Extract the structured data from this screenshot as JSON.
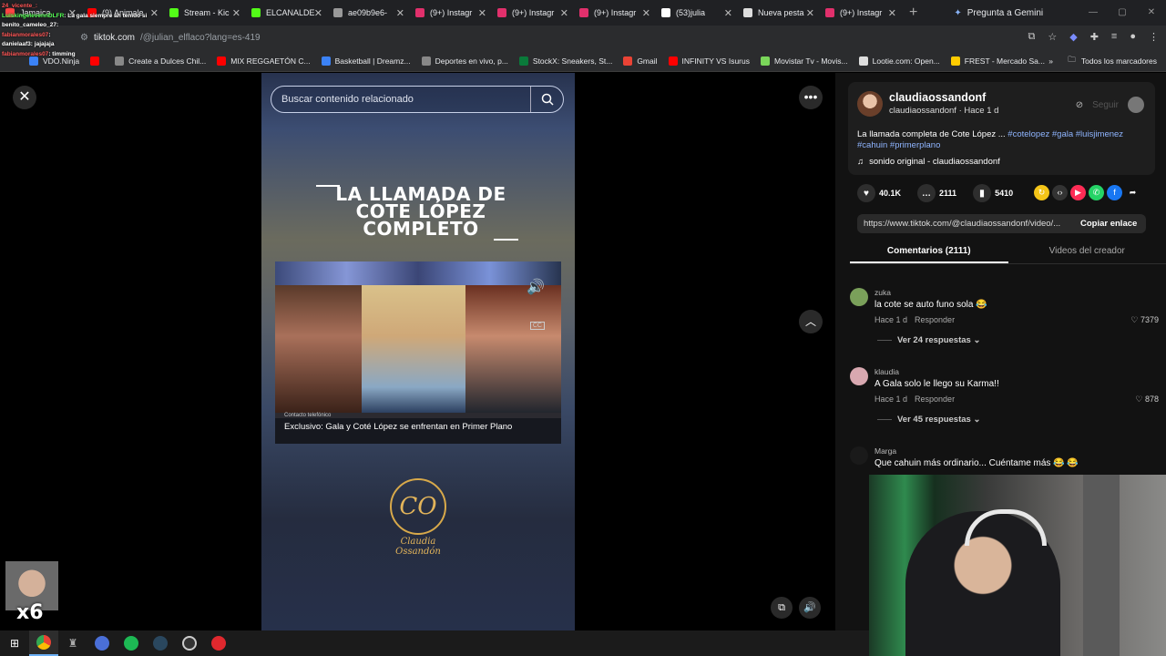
{
  "browser": {
    "tabs": [
      {
        "label": "Jamaica",
        "icon_color": "#ff4444"
      },
      {
        "label": "(9) Animale",
        "icon_color": "#ff0000"
      },
      {
        "label": "Stream - Kic",
        "icon_color": "#53fc18"
      },
      {
        "label": "ELCANALDE",
        "icon_color": "#53fc18"
      },
      {
        "label": "ae09b9e6-",
        "icon_color": "#999999"
      },
      {
        "label": "(9+) Instagr",
        "icon_color": "#e1306c"
      },
      {
        "label": "(9+) Instagr",
        "icon_color": "#e1306c"
      },
      {
        "label": "(9+) Instagr",
        "icon_color": "#e1306c"
      },
      {
        "label": "(53)julia",
        "icon_color": "#ffffff"
      },
      {
        "label": "Nueva pesta",
        "icon_color": "#dddddd"
      },
      {
        "label": "(9+) Instagr",
        "icon_color": "#e1306c"
      }
    ],
    "gemini_label": "Pregunta a Gemini",
    "address": {
      "domain": "tiktok.com",
      "path": "/@julian_elflaco?lang=es-419"
    },
    "bookmarks": [
      {
        "label": "VDO.Ninja",
        "color": "#3b82f6"
      },
      {
        "label": "",
        "color": "#ff0000"
      },
      {
        "label": "Create a Dulces Chil...",
        "color": "#888888"
      },
      {
        "label": "MIX REGGAETÓN C...",
        "color": "#ff0000"
      },
      {
        "label": "Basketball | Dreamz...",
        "color": "#3b82f6"
      },
      {
        "label": "Deportes en vivo, p...",
        "color": "#888888"
      },
      {
        "label": "StockX: Sneakers, St...",
        "color": "#0a7a3a"
      },
      {
        "label": "Gmail",
        "color": "#ea4335"
      },
      {
        "label": "INFINITY VS Isurus",
        "color": "#ff0000"
      },
      {
        "label": "Movistar Tv - Movis...",
        "color": "#7ad65a"
      },
      {
        "label": "Lootie.com: Open...",
        "color": "#dddddd"
      },
      {
        "label": "FREST - Mercado Sa...",
        "color": "#ffcc00"
      }
    ],
    "all_bookmarks": "Todos los marcadores"
  },
  "chat": [
    {
      "user": "24_vicente_:",
      "text": "",
      "color": "#ff5555"
    },
    {
      "user": "LuiskingelevennDLFR",
      "text": ": La gala siempre ah tenido si",
      "color": "#55ff55"
    },
    {
      "user": "benito_cameleo_27",
      "text": ":",
      "color": "#ffffff"
    },
    {
      "user": "fabianmorales07",
      "text": ":",
      "color": "#ff5555"
    },
    {
      "user": "danielaaf3",
      "text": ": jajajaja",
      "color": "#ffffff"
    },
    {
      "user": "fabianmorales07",
      "text": ": timming",
      "color": "#ff5555"
    }
  ],
  "video": {
    "search_placeholder": "Buscar contenido relacionado",
    "title_lines": [
      "LA LLAMADA DE",
      "COTE LÓPEZ",
      "COMPLETO"
    ],
    "clip_small": "Contacto telefónico",
    "clip_caption": "Exclusivo: Gala y Coté López se enfrentan en Primer Plano",
    "cc_label": "CC",
    "logo_mono": "CO",
    "logo_name": "Claudia Ossandón"
  },
  "post": {
    "username": "claudiaossandonf",
    "sub": "claudiaossandonf · Hace 1 d",
    "follow_label": "Seguir",
    "description": "La llamada completa de Cote López ... ",
    "hashtags": "#cotelopez #gala #luisjimenez #cahuin #primerplano",
    "sound": "sonido original - claudiaossandonf",
    "likes": "40.1K",
    "comments": "2111",
    "saves": "5410",
    "url": "https://www.tiktok.com/@claudiaossandonf/video/...",
    "copy_label": "Copiar enlace"
  },
  "tabs": {
    "comments": "Comentarios (2111)",
    "creator": "Videos del creador"
  },
  "comments": [
    {
      "user": "zuka",
      "text": "la cote se auto funo sola 😂",
      "time": "Hace 1 d",
      "reply": "Responder",
      "likes": "7379",
      "replies": "Ver 24 respuestas",
      "avatar": "#7aa05a"
    },
    {
      "user": "klaudia",
      "text": "A Gala solo le llego su Karma!!",
      "time": "Hace 1 d",
      "reply": "Responder",
      "likes": "878",
      "replies": "Ver 45 respuestas",
      "avatar": "#d8a8b0"
    },
    {
      "user": "Marga",
      "text": "Que cahuin más ordinario... Cuéntame más 😂 😂",
      "time": "",
      "reply": "",
      "likes": "",
      "replies": "",
      "avatar": "#1a1a1a"
    }
  ],
  "overlay": {
    "multiplier": "x6"
  }
}
